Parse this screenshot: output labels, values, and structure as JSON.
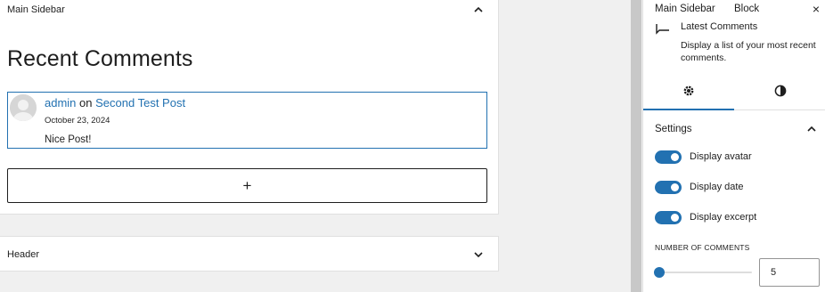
{
  "canvas": {
    "main_panel_title": "Main Sidebar",
    "widget_title": "Recent Comments",
    "comment": {
      "author": "admin",
      "connector": "on",
      "post_title": "Second Test Post",
      "date": "October 23, 2024",
      "excerpt": "Nice Post!"
    },
    "add_block_label": "+",
    "header_panel_title": "Header"
  },
  "sidebar": {
    "tabs": [
      "Main Sidebar",
      "Block"
    ],
    "close_label": "×",
    "block": {
      "name": "Latest Comments",
      "description": "Display a list of your most recent comments."
    },
    "settings_title": "Settings",
    "toggles": [
      {
        "label": "Display avatar",
        "on": true
      },
      {
        "label": "Display date",
        "on": true
      },
      {
        "label": "Display excerpt",
        "on": true
      }
    ],
    "number_of_comments": {
      "label": "NUMBER OF COMMENTS",
      "value": "5",
      "range_fraction": 0.0
    }
  },
  "colors": {
    "accent": "#2271b1",
    "text": "#1e1e1e",
    "canvas_bg": "#f0f0f0"
  },
  "icons": {
    "collapse": "chevron-up-icon",
    "expand": "chevron-down-icon",
    "block": "comment-icon",
    "settings_tab": "gear-icon",
    "styles_tab": "contrast-icon"
  }
}
